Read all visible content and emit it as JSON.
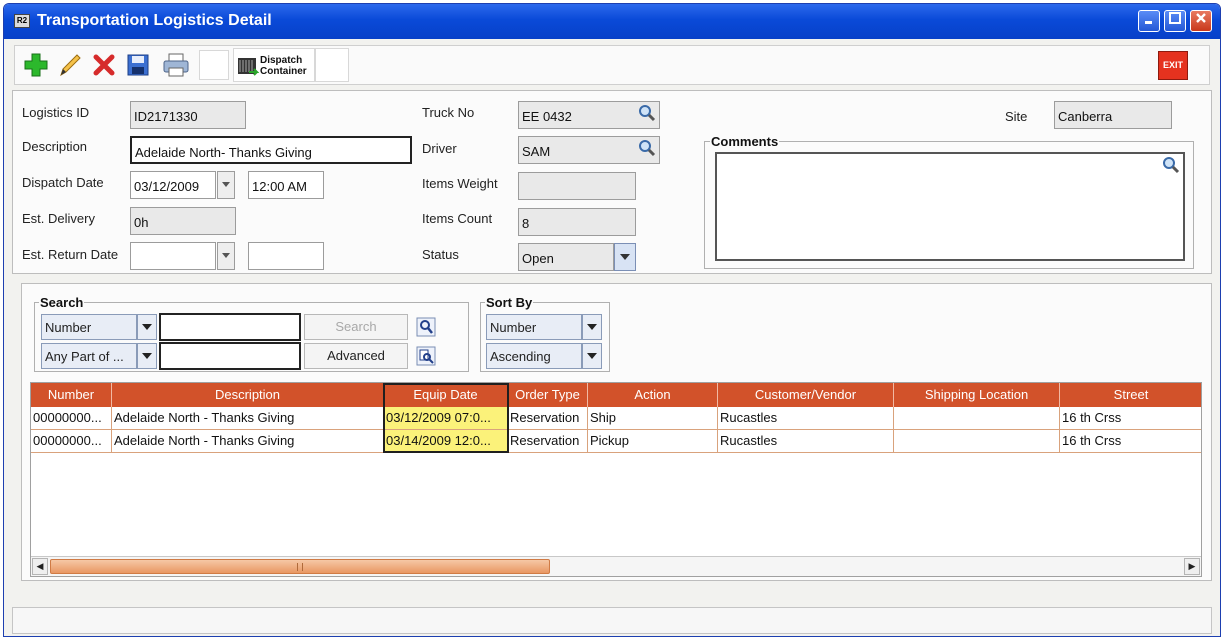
{
  "window": {
    "title": "Transportation Logistics Detail",
    "app_icon": "app-icon",
    "minimize_icon": "minimize-icon",
    "maximize_icon": "maximize-icon",
    "close_icon": "close-icon"
  },
  "toolbar": {
    "add_icon": "add-icon",
    "edit_icon": "edit-pencil-icon",
    "delete_icon": "delete-icon",
    "save_icon": "save-icon",
    "print_icon": "print-icon",
    "dispatch_label_1": "Dispatch",
    "dispatch_label_2": "Container",
    "exit_label": "EXIT"
  },
  "header": {
    "logistics_id_label": "Logistics ID",
    "logistics_id": "ID2171330",
    "description_label": "Description",
    "description": "Adelaide North- Thanks Giving",
    "dispatch_date_label": "Dispatch Date",
    "dispatch_date": "03/12/2009",
    "dispatch_time": "12:00 AM",
    "est_delivery_label": "Est. Delivery",
    "est_delivery": "0h",
    "est_return_date_label": "Est. Return Date",
    "est_return_date": "",
    "est_return_time": "",
    "truck_no_label": "Truck No",
    "truck_no": "EE 0432",
    "driver_label": "Driver",
    "driver": "SAM",
    "items_weight_label": "Items Weight",
    "items_weight": "",
    "items_count_label": "Items Count",
    "items_count": "8",
    "status_label": "Status",
    "status": "Open",
    "site_label": "Site",
    "site": "Canberra",
    "comments_label": "Comments",
    "comments": ""
  },
  "search": {
    "label": "Search",
    "field_select": "Number",
    "match_select": "Any Part of ...",
    "query": "",
    "query2": "",
    "search_button": "Search",
    "advanced_button": "Advanced"
  },
  "sort": {
    "label": "Sort By",
    "field": "Number",
    "order": "Ascending"
  },
  "colors": {
    "header_bg": "#d2522a",
    "highlight": "#fbf27a",
    "title_bar": "#0a4ad8"
  },
  "grid": {
    "columns": [
      "Number",
      "Description",
      "Equip Date",
      "Order Type",
      "Action",
      "Customer/Vendor",
      "Shipping Location",
      "Street"
    ],
    "rows": [
      [
        "00000000...",
        "Adelaide North - Thanks Giving",
        "03/12/2009 07:0...",
        "Reservation",
        "Ship",
        "Rucastles",
        "",
        "16 th Crss"
      ],
      [
        "00000000...",
        "Adelaide North - Thanks Giving",
        "03/14/2009 12:0...",
        "Reservation",
        "Pickup",
        "Rucastles",
        "",
        "16 th Crss"
      ]
    ]
  }
}
